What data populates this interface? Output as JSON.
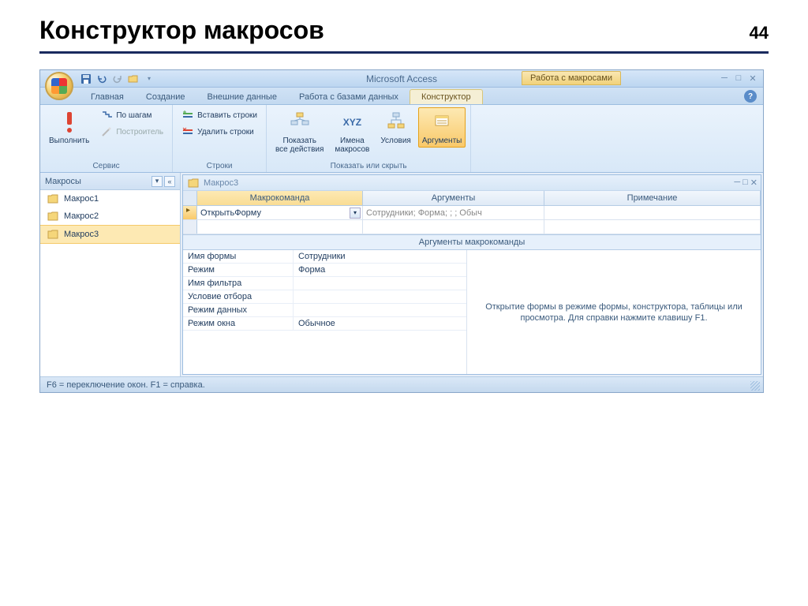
{
  "slide": {
    "title": "Конструктор макросов",
    "number": "44"
  },
  "title": {
    "app": "Microsoft Access",
    "context": "Работа с макросами"
  },
  "tabs": {
    "home": "Главная",
    "create": "Создание",
    "external": "Внешние данные",
    "db": "Работа с базами данных",
    "designer": "Конструктор"
  },
  "ribbon": {
    "run": "Выполнить",
    "step": "По шагам",
    "builder": "Построитель",
    "insert_rows": "Вставить строки",
    "delete_rows": "Удалить строки",
    "show_all": "Показать\nвсе действия",
    "macro_names": "Имена\nмакросов",
    "conditions": "Условия",
    "arguments": "Аргументы",
    "g_service": "Сервис",
    "g_rows": "Строки",
    "g_show": "Показать или скрыть"
  },
  "nav": {
    "title": "Макросы",
    "items": [
      "Макрос1",
      "Макрос2",
      "Макрос3"
    ]
  },
  "doc": {
    "title": "Макрос3",
    "cols": {
      "action": "Макрокоманда",
      "args": "Аргументы",
      "comment": "Примечание"
    },
    "row": {
      "action": "ОткрытьФорму",
      "args_preview": "Сотрудники; Форма; ; ; Обыч"
    },
    "args_title": "Аргументы макрокоманды",
    "args": [
      {
        "k": "Имя формы",
        "v": "Сотрудники"
      },
      {
        "k": "Режим",
        "v": "Форма"
      },
      {
        "k": "Имя фильтра",
        "v": ""
      },
      {
        "k": "Условие отбора",
        "v": ""
      },
      {
        "k": "Режим данных",
        "v": ""
      },
      {
        "k": "Режим окна",
        "v": "Обычное"
      }
    ],
    "help": "Открытие формы в режиме формы, конструктора, таблицы или просмотра. Для справки нажмите клавишу F1."
  },
  "statusbar": "F6 = переключение окон.  F1 = справка."
}
